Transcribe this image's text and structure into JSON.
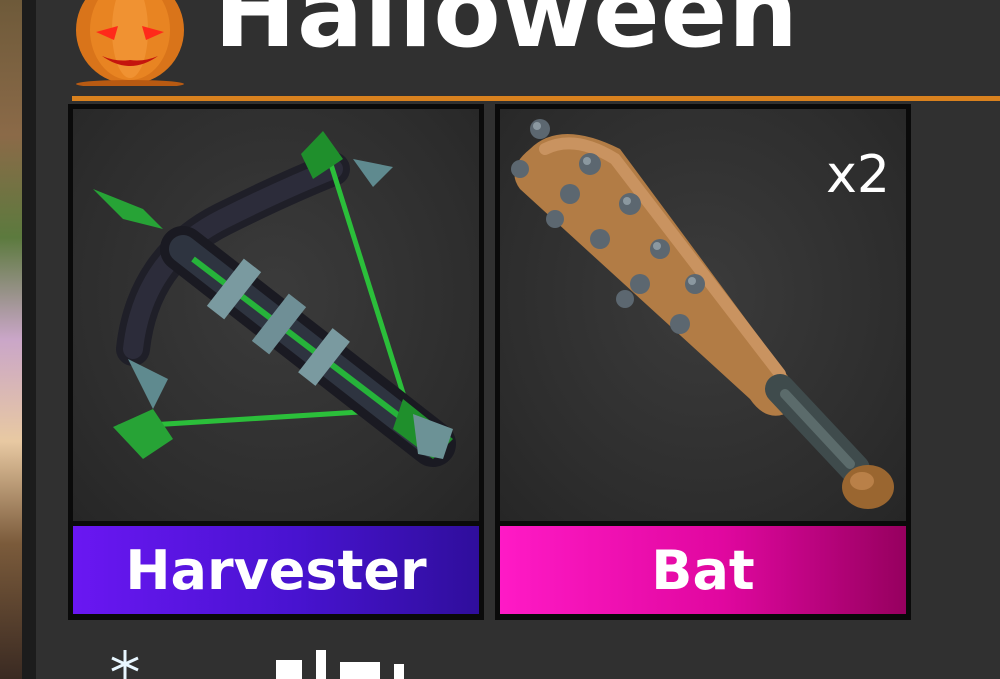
{
  "header": {
    "title": "Halloween",
    "icon": "pumpkin-icon",
    "accent_color": "#d9811e"
  },
  "items": [
    {
      "name": "Harvester",
      "icon": "crossbow-icon",
      "label_color": "#5a16e0"
    },
    {
      "name": "Bat",
      "quantity": "x2",
      "icon": "spiked-bat-icon",
      "label_color": "#e6089f"
    }
  ],
  "next_section": {
    "icon": "snowflake-icon"
  }
}
